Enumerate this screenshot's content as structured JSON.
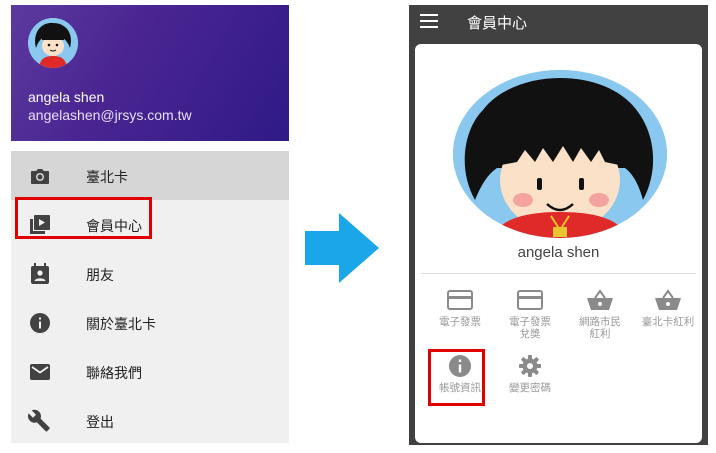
{
  "drawer": {
    "user_name": "angela shen",
    "user_email": "angelashen@jrsys.com.tw",
    "items": [
      {
        "label": "臺北卡",
        "icon": "camera-icon",
        "active": true
      },
      {
        "label": "會員中心",
        "icon": "video-library-icon",
        "active": false
      },
      {
        "label": "朋友",
        "icon": "calendar-person-icon",
        "active": false
      },
      {
        "label": "關於臺北卡",
        "icon": "info-icon",
        "active": false
      },
      {
        "label": "聯絡我們",
        "icon": "mail-icon",
        "active": false
      },
      {
        "label": "登出",
        "icon": "wrench-icon",
        "active": false
      }
    ]
  },
  "arrow": {
    "icon": "right-arrow-icon",
    "color": "#1aa6e8"
  },
  "phone": {
    "title": "會員中心",
    "profile_name": "angela shen",
    "features": [
      {
        "label": "電子發票",
        "icon": "card-icon"
      },
      {
        "label": "電子發票\n兌獎",
        "icon": "card-icon"
      },
      {
        "label": "網路市民\n紅利",
        "icon": "basket-icon"
      },
      {
        "label": "臺北卡紅利",
        "icon": "basket-icon"
      },
      {
        "label": "帳號資訊",
        "icon": "info-icon"
      },
      {
        "label": "變更密碼",
        "icon": "gear-icon"
      }
    ]
  },
  "colors": {
    "highlight": "#e00000",
    "accent": "#1aa6e8",
    "drawer_header": "#4a2592"
  }
}
